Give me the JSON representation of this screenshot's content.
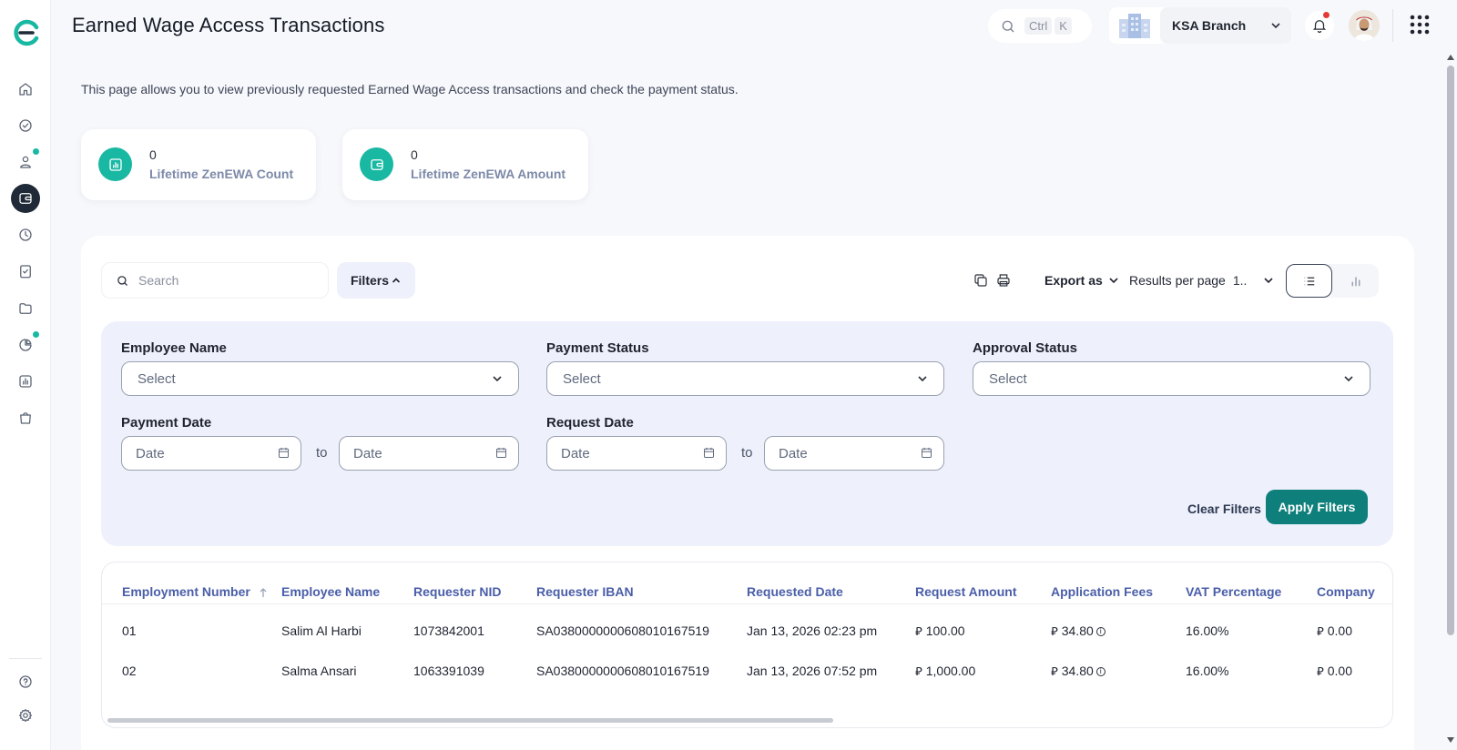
{
  "page": {
    "title": "Earned Wage Access Transactions",
    "description": "This page allows you to view previously requested Earned Wage Access transactions and check the payment status."
  },
  "header": {
    "search_shortcut": [
      "Ctrl",
      "K"
    ],
    "branch": "KSA Branch",
    "notification_badge_color": "#e53935"
  },
  "sidebar": {
    "active_color": "#1f2937",
    "dot_color": "#19b8a3",
    "items": [
      {
        "icon": "home-icon"
      },
      {
        "icon": "check-circle-icon"
      },
      {
        "icon": "user-icon",
        "dot": true
      },
      {
        "icon": "wallet-icon",
        "active": true
      },
      {
        "icon": "clock-icon"
      },
      {
        "icon": "clipboard-check-icon"
      },
      {
        "icon": "folder-icon"
      },
      {
        "icon": "pie-chart-icon",
        "dot": true
      },
      {
        "icon": "bar-chart-icon"
      },
      {
        "icon": "bag-icon"
      },
      {
        "icon": "help-icon"
      },
      {
        "icon": "gear-icon"
      }
    ]
  },
  "stats": [
    {
      "value": "0",
      "label": "Lifetime ZenEWA Count"
    },
    {
      "value": "0",
      "label": "Lifetime ZenEWA Amount"
    }
  ],
  "toolbar": {
    "search_placeholder": "Search",
    "filters_label": "Filters",
    "export_label": "Export as",
    "results_per_page_label": "Results per page",
    "results_per_page_value": "1.."
  },
  "filters": {
    "employee_name": {
      "label": "Employee Name",
      "placeholder": "Select"
    },
    "payment_status": {
      "label": "Payment Status",
      "placeholder": "Select"
    },
    "approval_status": {
      "label": "Approval Status",
      "placeholder": "Select"
    },
    "payment_date": {
      "label": "Payment Date",
      "from": "Date",
      "to_label": "to",
      "to": "Date"
    },
    "request_date": {
      "label": "Request Date",
      "from": "Date",
      "to_label": "to",
      "to": "Date"
    },
    "clear_label": "Clear Filters",
    "apply_label": "Apply Filters",
    "apply_color": "#0f7f7b"
  },
  "table": {
    "columns": [
      "Employment Number",
      "Employee Name",
      "Requester NID",
      "Requester IBAN",
      "Requested Date",
      "Request Amount",
      "Application Fees",
      "VAT Percentage",
      "Company"
    ],
    "rows": [
      {
        "emp_no": "01",
        "name": "Salim Al Harbi",
        "nid": "1073842001",
        "iban": "SA0380000000608010167519",
        "date": "Jan 13, 2026 02:23 pm",
        "amount": "100.00",
        "fees": "34.80",
        "vat": "16.00%",
        "company": "0.00"
      },
      {
        "emp_no": "02",
        "name": "Salma Ansari",
        "nid": "1063391039",
        "iban": "SA0380000000608010167519",
        "date": "Jan 13, 2026 07:52 pm",
        "amount": "1,000.00",
        "fees": "34.80",
        "vat": "16.00%",
        "company": "0.00"
      }
    ]
  },
  "colors": {
    "accent_teal": "#19b8a3",
    "header_link_blue": "#4a5ea8",
    "filter_bg": "#eef1fc"
  }
}
